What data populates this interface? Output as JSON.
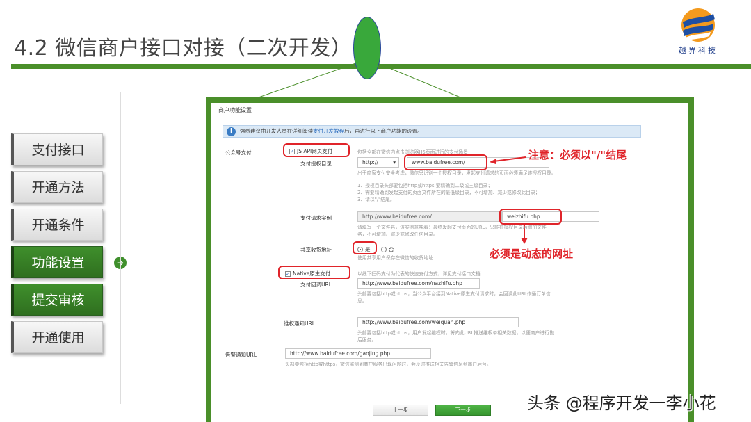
{
  "slide": {
    "title": "4.2 微信商户接口对接（二次开发）",
    "logo_text": "越界科技"
  },
  "colors": {
    "brand_green": "#4a8f2a",
    "annotation_red": "#e0242a",
    "info_blue": "#dbe9f6"
  },
  "nav": {
    "items": [
      {
        "label": "支付接口",
        "active": false
      },
      {
        "label": "开通方法",
        "active": false
      },
      {
        "label": "开通条件",
        "active": false
      },
      {
        "label": "功能设置",
        "active": true
      },
      {
        "label": "提交审核",
        "active": true
      },
      {
        "label": "开通使用",
        "active": false
      }
    ],
    "arrow_icon": "arrow-right-circle-icon"
  },
  "panel": {
    "title": "商户功能设置",
    "info_text": "强烈建议由开发人员在详细阅读",
    "info_link": "支付开发教程",
    "info_text_after": "后，再进行以下商户功能的设置。",
    "section_label": "公众号支付",
    "jsapi": {
      "label": "JS API网页支付",
      "checked": true,
      "desc": "包括全部在微信内点击浏览器H5页面进行的支付场景",
      "dir_label": "支付授权目录",
      "protocol": "http://",
      "dir_value": "www.baidufree.com/",
      "dir_hint": [
        "出于商家支付安全考虑，微信只识别一个授权目录，发起支付请求的页面必须满足该授权目录。",
        "1、授权目录头部要包括http或https,要精确到二级或三级目录；",
        "2、需要精确到发起支付的页面文件所在的最低级目录，不可增加、减少或修改此目录；",
        "3、请以\"/\"结尾。"
      ],
      "req_label": "支付请求实例",
      "req_prefix": "http://www.baidufree.com/",
      "req_file": "weizhifu.php",
      "req_hint": [
        "请填写一个文件名，该实例意味着：最终发起支付页面的URL，只能在授权目录后增加文件",
        "名，不可增加、减少或修改任何目录。"
      ],
      "share_label": "共享收货地址",
      "share_yes": "是",
      "share_no": "否",
      "share_hint": "使用共享用户保存在微信的收货地址"
    },
    "native": {
      "label": "Native原生支付",
      "checked": true,
      "desc": "以线下扫码支付为代表的快速支付方式，详见支付接口文档",
      "callback_label": "支付回调URL",
      "callback_value": "http://www.baidufree.com/nazhifu.php",
      "callback_hint": [
        "头部要包括http或https，当公众平台接到Native原生支付请求时，会回调此URL作通订单信",
        "息。"
      ]
    },
    "rights": {
      "label": "维权通知URL",
      "value": "http://www.baidufree.com/weiquan.php",
      "hint": [
        "头部要包括http或https，用户发起维权时，将向此URL推送维权单相关数据，以便商户进行售",
        "后服务。"
      ]
    },
    "alarm": {
      "label": "告警通知URL",
      "value": "http://www.baidufree.com/gaojing.php",
      "hint": "头部要包括http或https，微信监测到商户服务出现问题时，会及时推送相关告警信息到商户后台。"
    },
    "buttons": {
      "prev": "上一步",
      "next": "下一步"
    }
  },
  "annotations": {
    "note_slash": "注意：必须以\"/\"结尾",
    "note_dynamic": "必须是动态的网址"
  },
  "watermark": "头条 @程序开发一李小花"
}
